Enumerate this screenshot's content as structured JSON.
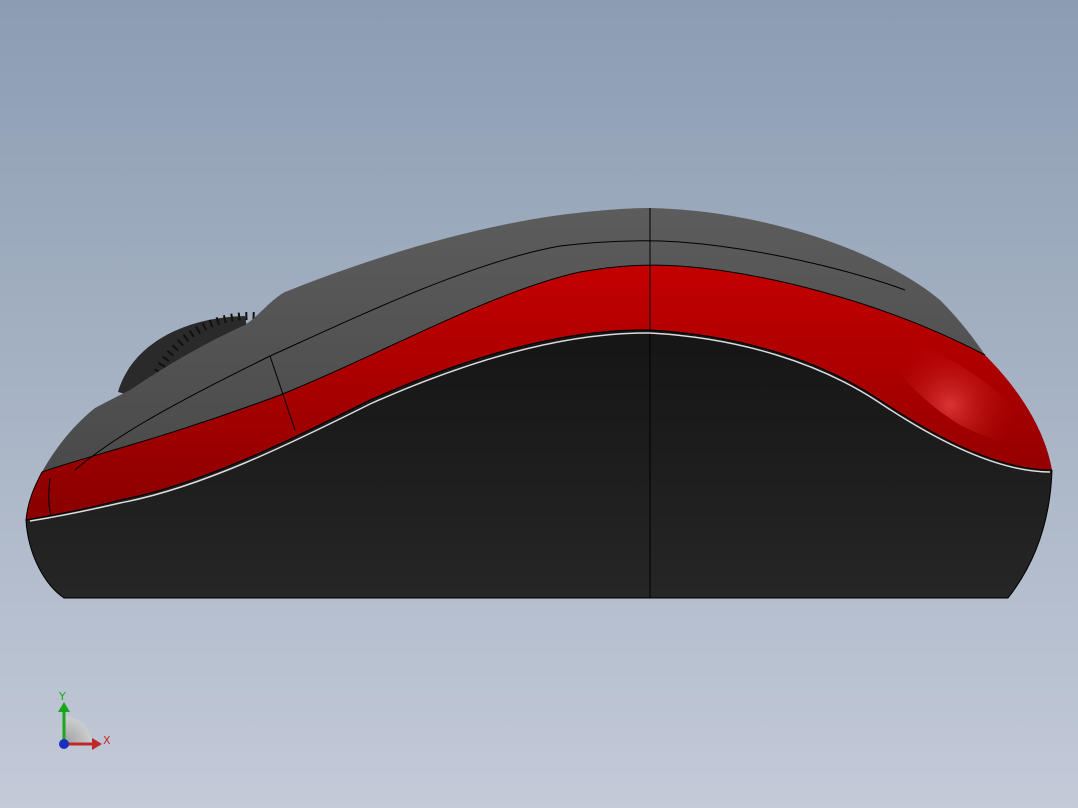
{
  "viewport": {
    "background_top": "#8c9db2",
    "background_bottom": "#c3cad8"
  },
  "model": {
    "name": "mouse-side-view",
    "colors": {
      "body_dark": "#1c1c1c",
      "shell_gray": "#5a5a5a",
      "shell_gray_light": "#6e6e6e",
      "accent_red": "#b00000",
      "accent_red_highlight": "#d62a2a",
      "wheel": "#2a2a2a",
      "edge_line": "#000000"
    }
  },
  "triad": {
    "x_label": "X",
    "y_label": "Y",
    "x_color": "#c0282a",
    "y_color": "#1aa81a",
    "z_color": "#1a2fc0"
  }
}
